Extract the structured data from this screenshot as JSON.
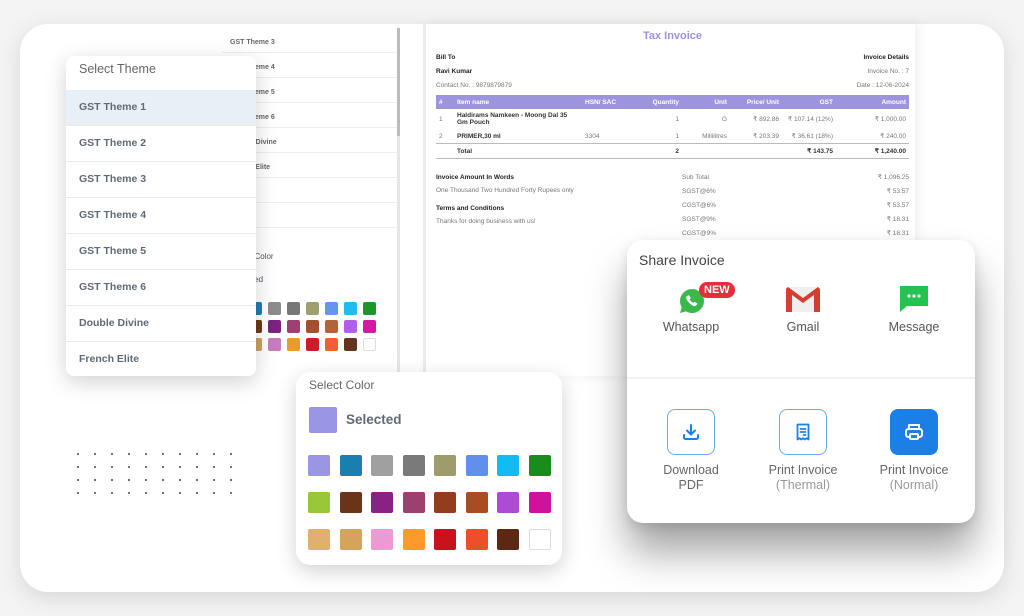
{
  "background_theme_list": {
    "items": [
      "GST Theme 3",
      "GST Theme 4",
      "GST Theme 5",
      "GST Theme 6",
      "Double Divine",
      "French Elite",
      "",
      ""
    ],
    "color_title": "Select Color",
    "selected_label": "Selected",
    "swatches": [
      "#9b96e4",
      "#1a7fae",
      "#8c8c8c",
      "#777777",
      "#a0a06e",
      "#6696ec",
      "#1ebcf0",
      "#1c9628",
      "#a0c834",
      "#6e3a18",
      "#7c2280",
      "#9a4272",
      "#a4502e",
      "#b0643a",
      "#b060e0",
      "#d41aa0",
      "#e8b070",
      "#caa060",
      "#c87cc0",
      "#ec9a2c",
      "#cc1c28",
      "#f06030",
      "#643420",
      "#ffffff"
    ]
  },
  "invoice": {
    "title": "Tax Invoice",
    "bill_to_label": "Bill To",
    "customer_name": "Ravi Kumar",
    "contact": "Contact No. : 9879879879",
    "details_label": "Invoice Details",
    "invoice_no": "Invoice No. : 7",
    "date": "Date : 12-06-2024",
    "columns": [
      "#",
      "Item name",
      "HSN/ SAC",
      "Quantity",
      "Unit",
      "Price/ Unit",
      "GST",
      "Amount"
    ],
    "rows": [
      {
        "no": "1",
        "name": "Haldirams Namkeen - Moong Dal 35 Gm Pouch",
        "hsn": "",
        "qty": "1",
        "unit": "G",
        "price": "₹ 892.86",
        "gst": "₹ 107.14 (12%)",
        "amount": "₹ 1,000.00"
      },
      {
        "no": "2",
        "name": "PRIMER,30 ml",
        "hsn": "3304",
        "qty": "1",
        "unit": "Millilitres",
        "price": "₹ 203.39",
        "gst": "₹ 36.61 (18%)",
        "amount": "₹ 240.00"
      }
    ],
    "total": {
      "label": "Total",
      "qty": "2",
      "gst": "₹ 143.75",
      "amount": "₹ 1,240.00"
    },
    "amount_words_label": "Invoice Amount In Words",
    "amount_words": "One Thousand Two Hundred Forty Rupees only",
    "terms_label": "Terms and Conditions",
    "terms": "Thanks for doing business with us!",
    "summary": [
      {
        "label": "Sub Total",
        "value": "₹ 1,096.25"
      },
      {
        "label": "SGST@6%",
        "value": "₹ 53.57"
      },
      {
        "label": "CGST@6%",
        "value": "₹ 53.57"
      },
      {
        "label": "SGST@9%",
        "value": "₹ 18.31"
      },
      {
        "label": "CGST@9%",
        "value": "₹ 18.31"
      }
    ]
  },
  "theme_menu": {
    "title": "Select Theme",
    "items": [
      "GST Theme 1",
      "GST Theme 2",
      "GST Theme 3",
      "GST Theme 4",
      "GST Theme 5",
      "GST Theme 6",
      "Double Divine",
      "French Elite"
    ],
    "active_index": 0
  },
  "color_picker": {
    "title": "Select Color",
    "selected_label": "Selected",
    "selected_color": "#9b96e4",
    "swatches": [
      "#9b96e4",
      "#1a7fae",
      "#a0a0a0",
      "#7a7a7a",
      "#9c9c6c",
      "#5f90ea",
      "#12bcf2",
      "#188c1c",
      "#98c83a",
      "#6a3418",
      "#8a2284",
      "#9c4070",
      "#943c1e",
      "#a84c22",
      "#ac4cd4",
      "#d0129a",
      "#e0b070",
      "#d4a45c",
      "#ec9ad4",
      "#fc9a2c",
      "#c8121c",
      "#ec5028",
      "#5c2814",
      "#ffffff"
    ]
  },
  "share": {
    "title": "Share Invoice",
    "options": [
      {
        "label": "Whatsapp",
        "icon": "whatsapp-icon",
        "badge": "NEW"
      },
      {
        "label": "Gmail",
        "icon": "gmail-icon"
      },
      {
        "label": "Message",
        "icon": "message-icon"
      }
    ],
    "actions": [
      {
        "label": "Download",
        "sub": "PDF",
        "icon": "download-icon"
      },
      {
        "label": "Print Invoice",
        "sub": "(Thermal)",
        "icon": "receipt-icon"
      },
      {
        "label": "Print Invoice",
        "sub": "(Normal)",
        "icon": "printer-icon"
      }
    ],
    "accent_color": "#1c7fe6",
    "badge_color": "#e52e3a"
  }
}
